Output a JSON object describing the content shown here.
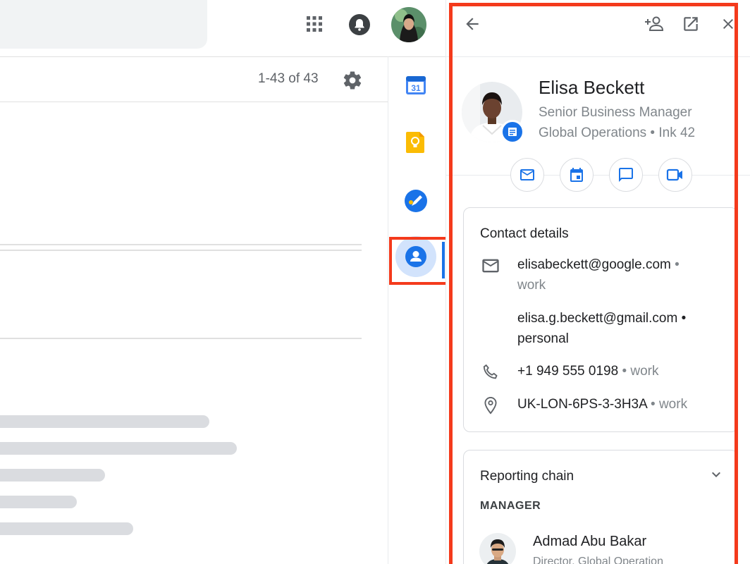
{
  "pager": {
    "range_text": "1-43 of 43"
  },
  "contact": {
    "name": "Elisa Beckett",
    "title": "Senior Business Manager",
    "org": "Global Operations • Ink 42"
  },
  "contact_details": {
    "heading": "Contact details",
    "rows": [
      {
        "icon": "email-icon",
        "value": "elisabeckett@google.com",
        "sep": " •",
        "label": "work"
      },
      {
        "icon": "",
        "value": "elisa.g.beckett@gmail.com",
        "sep": " •",
        "label": "personal"
      },
      {
        "icon": "phone-icon",
        "value": "+1 949 555 0198",
        "sep": " •",
        "label": "work"
      },
      {
        "icon": "location-pin-icon",
        "value": "UK-LON-6PS-3-3H3A",
        "sep": " •",
        "label": "work"
      }
    ]
  },
  "reporting_chain": {
    "heading": "Reporting chain",
    "section_label": "MANAGER",
    "manager": {
      "name": "Admad Abu Bakar",
      "role": "Director, Global Operation"
    }
  },
  "colors": {
    "accent": "#1a73e8",
    "highlight": "#f43a1c",
    "calendar_blue": "#4285f4",
    "keep_yellow": "#fbbc04"
  },
  "icons": {
    "panel_header": [
      "back-arrow-icon",
      "add-person-icon",
      "open-in-new-icon",
      "close-icon"
    ],
    "rail": [
      "calendar-icon",
      "keep-icon",
      "tasks-icon",
      "contacts-icon"
    ],
    "actions": [
      "email-icon",
      "calendar-icon",
      "chat-icon",
      "video-call-icon"
    ],
    "calendar_icon_text": "31"
  }
}
